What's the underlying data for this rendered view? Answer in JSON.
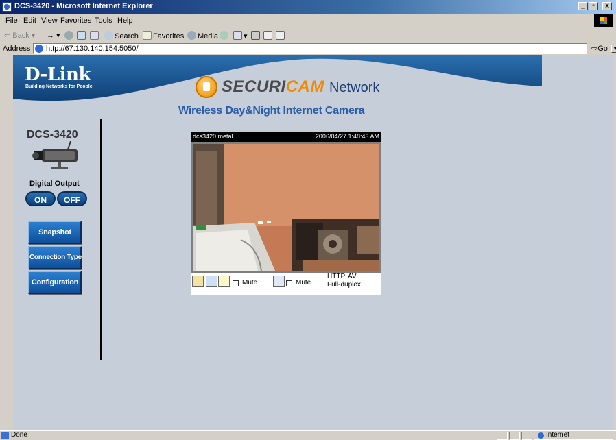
{
  "window": {
    "title": "DCS-3420 - Microsoft Internet Explorer",
    "minimize": "_",
    "maximize": "▫",
    "close": "x"
  },
  "menu": [
    "File",
    "Edit",
    "View",
    "Favorites",
    "Tools",
    "Help"
  ],
  "toolbar": {
    "back": "Back",
    "search": "Search",
    "favorites": "Favorites",
    "media": "Media"
  },
  "address": {
    "label": "Address",
    "url": "http://67.130.140.154:5050/",
    "go": "Go"
  },
  "page": {
    "logo": "D-Link",
    "logo_tagline": "Building Networks for People",
    "brand_securi": "SECURI",
    "brand_cam": "CAM",
    "brand_network": "Network",
    "subtitle": "Wireless Day&Night Internet Camera",
    "model": "DCS-3420",
    "digital_output_label": "Digital Output",
    "on_button": "ON",
    "off_button": "OFF",
    "nav": {
      "snapshot": "Snapshot",
      "connection_type": "Connection Type",
      "configuration": "Configuration"
    },
    "viewer": {
      "camera_name": "dcs3420 metal",
      "timestamp": "2006/04/27 1:48:43 AM",
      "mute_speaker": "Mute",
      "mute_mic": "Mute",
      "protocol": "HTTP",
      "av": "AV",
      "duplex": "Full-duplex"
    }
  },
  "status": {
    "text": "Done",
    "zone": "Internet"
  },
  "colors": {
    "banner_blue": "#1b5a93",
    "page_bg": "#c6cfd9",
    "button_blue": "#1a65b5",
    "brand_orange": "#f08a00",
    "subtitle_blue": "#2a5caa"
  }
}
